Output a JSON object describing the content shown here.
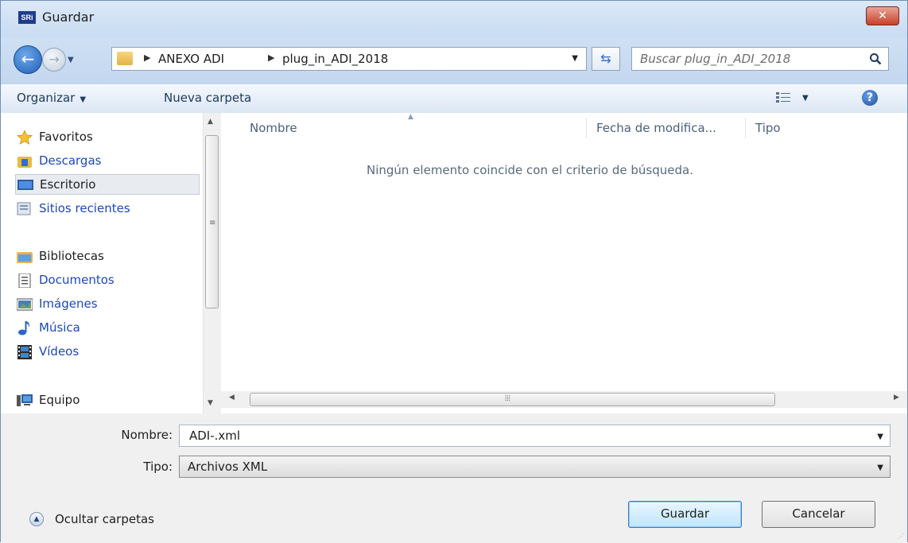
{
  "window": {
    "title": "Guardar",
    "app_logo_text": "SRi",
    "close_glyph": "✕"
  },
  "address": {
    "crumbs": [
      "ANEXO ADI",
      "plug_in_ADI_2018"
    ],
    "search_placeholder": "Buscar plug_in_ADI_2018"
  },
  "toolbar": {
    "organize_label": "Organizar",
    "new_folder_label": "Nueva carpeta"
  },
  "nav": {
    "favorites": "Favoritos",
    "downloads": "Descargas",
    "desktop": "Escritorio",
    "recent": "Sitios recientes",
    "libraries": "Bibliotecas",
    "documents": "Documentos",
    "pictures": "Imágenes",
    "music": "Música",
    "videos": "Vídeos",
    "computer": "Equipo"
  },
  "files": {
    "columns": [
      "Nombre",
      "Fecha de modifica...",
      "Tipo"
    ],
    "empty_message": "Ningún elemento coincide con el criterio de búsqueda."
  },
  "form": {
    "name_label": "Nombre:",
    "name_value": "ADI-.xml",
    "type_label": "Tipo:",
    "type_value": "Archivos XML",
    "hide_folders_label": "Ocultar carpetas",
    "save_label": "Guardar",
    "cancel_label": "Cancelar"
  },
  "colors": {
    "link": "#1c48b8",
    "title_bar": "#c9dcf2",
    "close_button": "#c8402a"
  }
}
